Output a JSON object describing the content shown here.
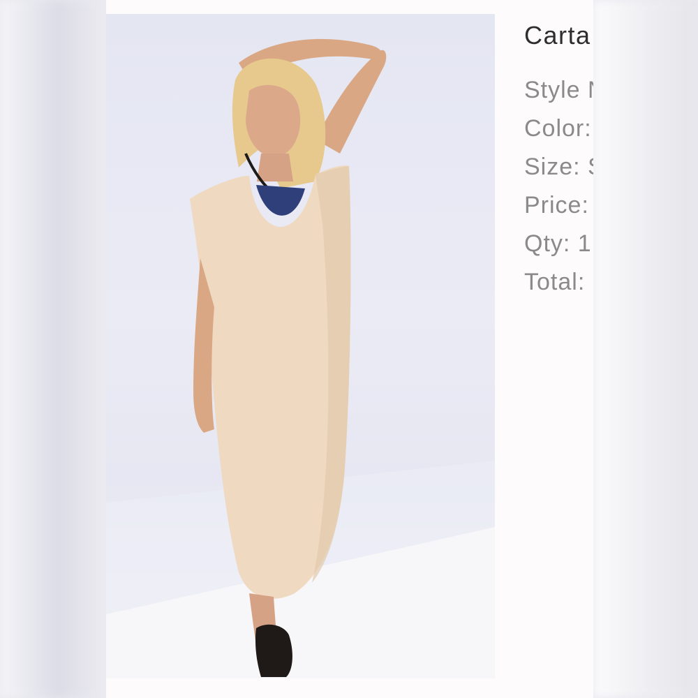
{
  "product": {
    "title": "Carta",
    "image_alt": "Model wearing a long beige sleeveless dress",
    "fields": [
      {
        "key": "style",
        "text": "Style N"
      },
      {
        "key": "color",
        "text": "Color:"
      },
      {
        "key": "size",
        "text": "Size:  S"
      },
      {
        "key": "price",
        "text": "Price:"
      },
      {
        "key": "qty",
        "text": "Qty: 1"
      },
      {
        "key": "total",
        "text": "Total:"
      }
    ]
  },
  "colors": {
    "dress": "#efd9c0",
    "sky": "#e4e6f2",
    "ground": "#f4f3f6",
    "title_text": "#2e2e2e",
    "field_text": "#8a8a8a"
  }
}
